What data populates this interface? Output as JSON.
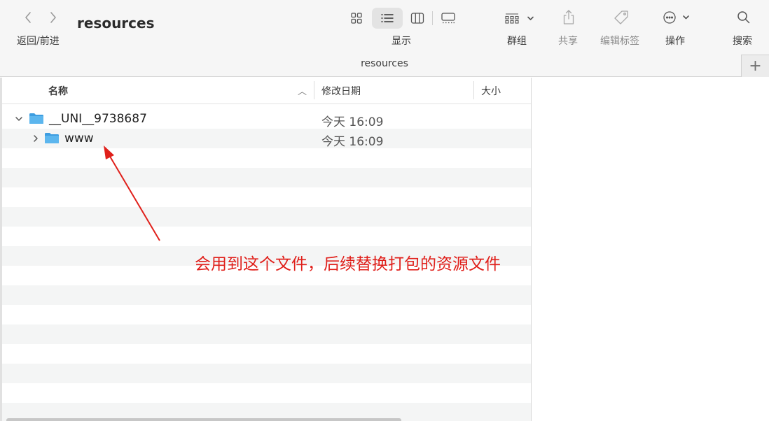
{
  "toolbar": {
    "nav_label": "返回/前进",
    "title": "resources",
    "view_label": "显示",
    "group_label": "群组",
    "share_label": "共享",
    "tags_label": "编辑标签",
    "action_label": "操作",
    "search_label": "搜索"
  },
  "pathbar": {
    "title": "resources",
    "add_tab": "+"
  },
  "columns": {
    "name": "名称",
    "sort_indicator": "︿",
    "date": "修改日期",
    "size": "大小"
  },
  "files": [
    {
      "name": "__UNI__9738687",
      "date": "今天 16:09",
      "expanded": true,
      "level": 0
    },
    {
      "name": "www",
      "date": "今天 16:09",
      "expanded": false,
      "level": 1
    }
  ],
  "annotation": {
    "text": "会用到这个文件，后续替换打包的资源文件",
    "color": "#e0201b"
  },
  "colors": {
    "folder": "#4aa8e6",
    "row_alt": "#f4f5f5",
    "toolbar_bg": "#f6f6f6"
  }
}
